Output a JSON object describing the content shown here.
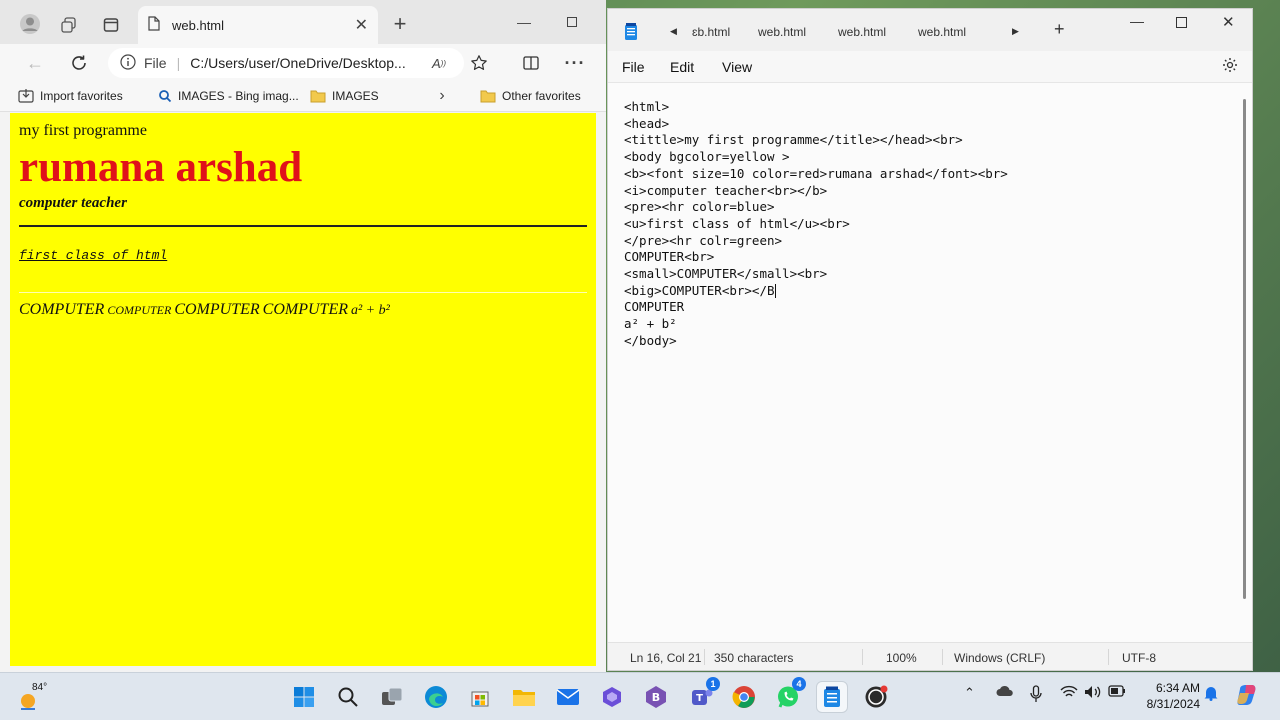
{
  "browser": {
    "tab_title": "web.html",
    "address_label": "File",
    "address": "C:/Users/user/OneDrive/Desktop...",
    "favorites": [
      {
        "label": "Import favorites",
        "icon": "import-icon"
      },
      {
        "label": "IMAGES - Bing imag...",
        "icon": "search-icon"
      },
      {
        "label": "IMAGES",
        "icon": "folder-icon"
      },
      {
        "label": "Other favorites",
        "icon": "folder-icon"
      }
    ],
    "page": {
      "title_line": "my first programme",
      "name": "rumana arshad",
      "role": "computer teacher",
      "class_line": "first class of html",
      "computer_words": [
        "COMPUTER",
        "COMPUTER",
        "COMPUTER",
        "COMPUTER"
      ],
      "formula": "a² + b²",
      "background": "#ffff00",
      "name_color": "#e0111a"
    }
  },
  "notepad": {
    "tabs": [
      "ɛb.html",
      "web.html",
      "web.html",
      "web.html"
    ],
    "menu": {
      "file": "File",
      "edit": "Edit",
      "view": "View"
    },
    "lines": [
      "<html>",
      "",
      "<head>",
      "<tittle>my first programme</title></head><br>",
      "",
      "",
      "",
      "<body bgcolor=yellow >",
      "<b><font size=10 color=red>rumana arshad</font><br>",
      "<i>computer teacher<br></b>",
      "<pre><hr color=blue>",
      "<u>first class of html</u><br>",
      "</pre><hr colr=green>",
      "COMPUTER<br>",
      "<small>COMPUTER</small><br>",
      "<big>COMPUTER<br></B",
      "COMPUTER",
      "",
      "",
      "",
      "",
      "a² + b²",
      "",
      "",
      "",
      "",
      "",
      "",
      "",
      "",
      "",
      "</body>"
    ],
    "status": {
      "position": "Ln 16, Col 21",
      "characters": "350 characters",
      "zoom": "100%",
      "line_ending": "Windows (CRLF)",
      "encoding": "UTF-8"
    }
  },
  "taskbar": {
    "weather": "84°",
    "time": "6:34 AM",
    "date": "8/31/2024",
    "teams_badge": "1",
    "whatsapp_badge": "4"
  }
}
